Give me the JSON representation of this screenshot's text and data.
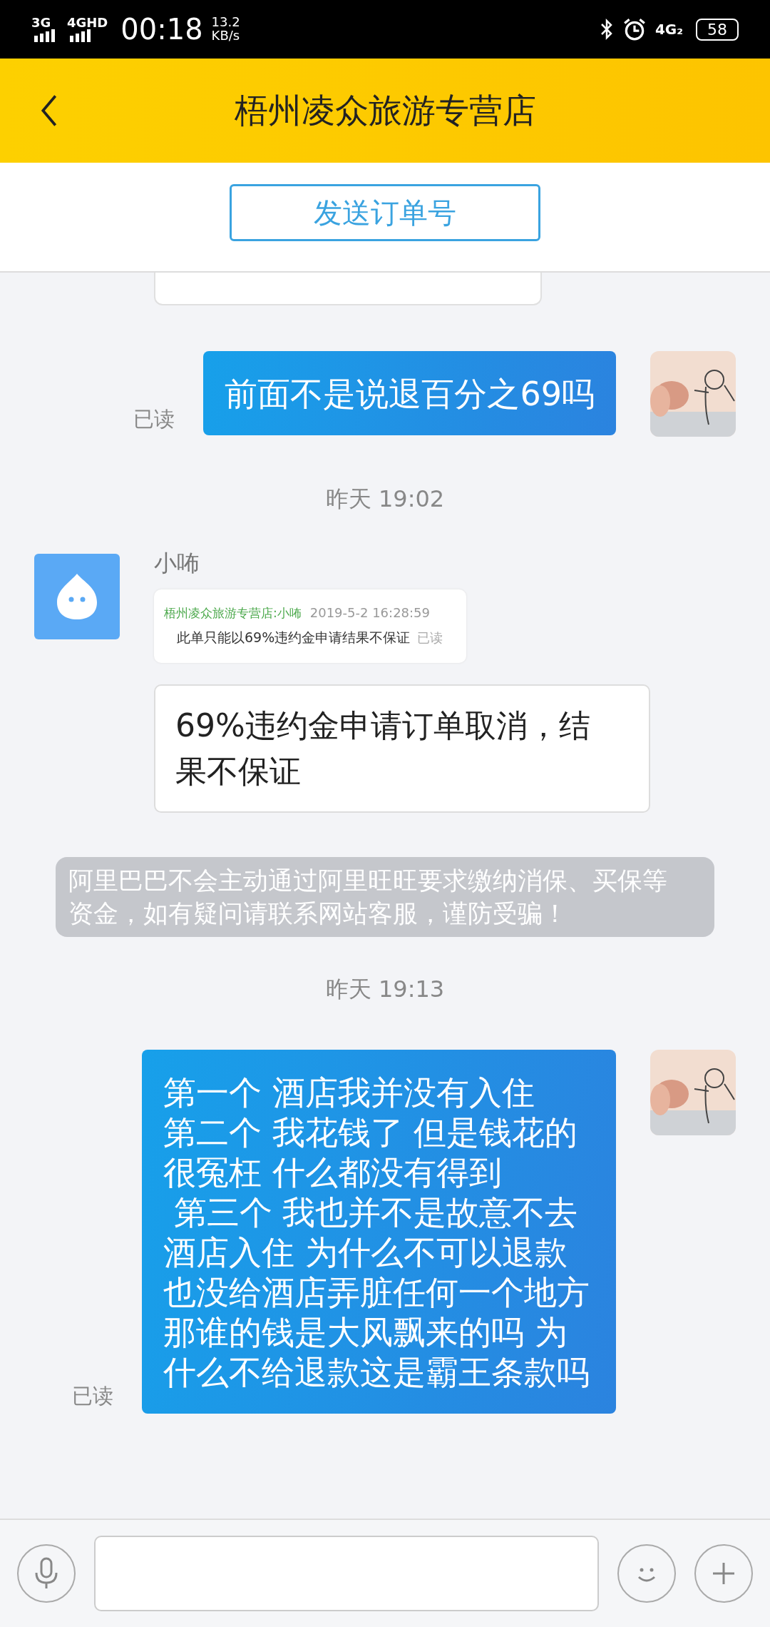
{
  "status_bar": {
    "network_1": "3G",
    "network_2": "4GHD",
    "time": "00:18",
    "speed_value": "13.2",
    "speed_unit": "KB/s",
    "network_3": "4G₂",
    "battery": "58"
  },
  "header": {
    "title": "梧州凌众旅游专营店"
  },
  "order_button": {
    "label": "发送订单号"
  },
  "messages": [
    {
      "kind": "cutoff"
    },
    {
      "kind": "sent",
      "paragraphs": [
        "前面不是说退百分之69吗"
      ],
      "status": "已读"
    },
    {
      "kind": "time",
      "text": "昨天 19:02"
    },
    {
      "kind": "received",
      "sender": "小咘",
      "items": [
        {
          "kind": "quote",
          "header": "梧州凌众旅游专营店:小咘",
          "time": "2019-5-2 16:28:59",
          "text": "此单只能以69%违约金申请结果不保证",
          "status": "已读"
        },
        {
          "kind": "text",
          "text": "69%违约金申请订单取消，结果不保证"
        }
      ]
    },
    {
      "kind": "notice",
      "text": "阿里巴巴不会主动通过阿里旺旺要求缴纳消保、买保等资金，如有疑问请联系网站客服，谨防受骗！"
    },
    {
      "kind": "time",
      "text": "昨天 19:13"
    },
    {
      "kind": "sent",
      "paragraphs": [
        "第一个 酒店我并没有入住",
        "第二个 我花钱了 但是钱花的很冤枉 什么都没有得到",
        " 第三个 我也并不是故意不去酒店入住 为什么不可以退款也没给酒店弄脏任何一个地方那谁的钱是大风飘来的吗 为什么不给退款这是霸王条款吗"
      ],
      "status": "已读"
    }
  ]
}
